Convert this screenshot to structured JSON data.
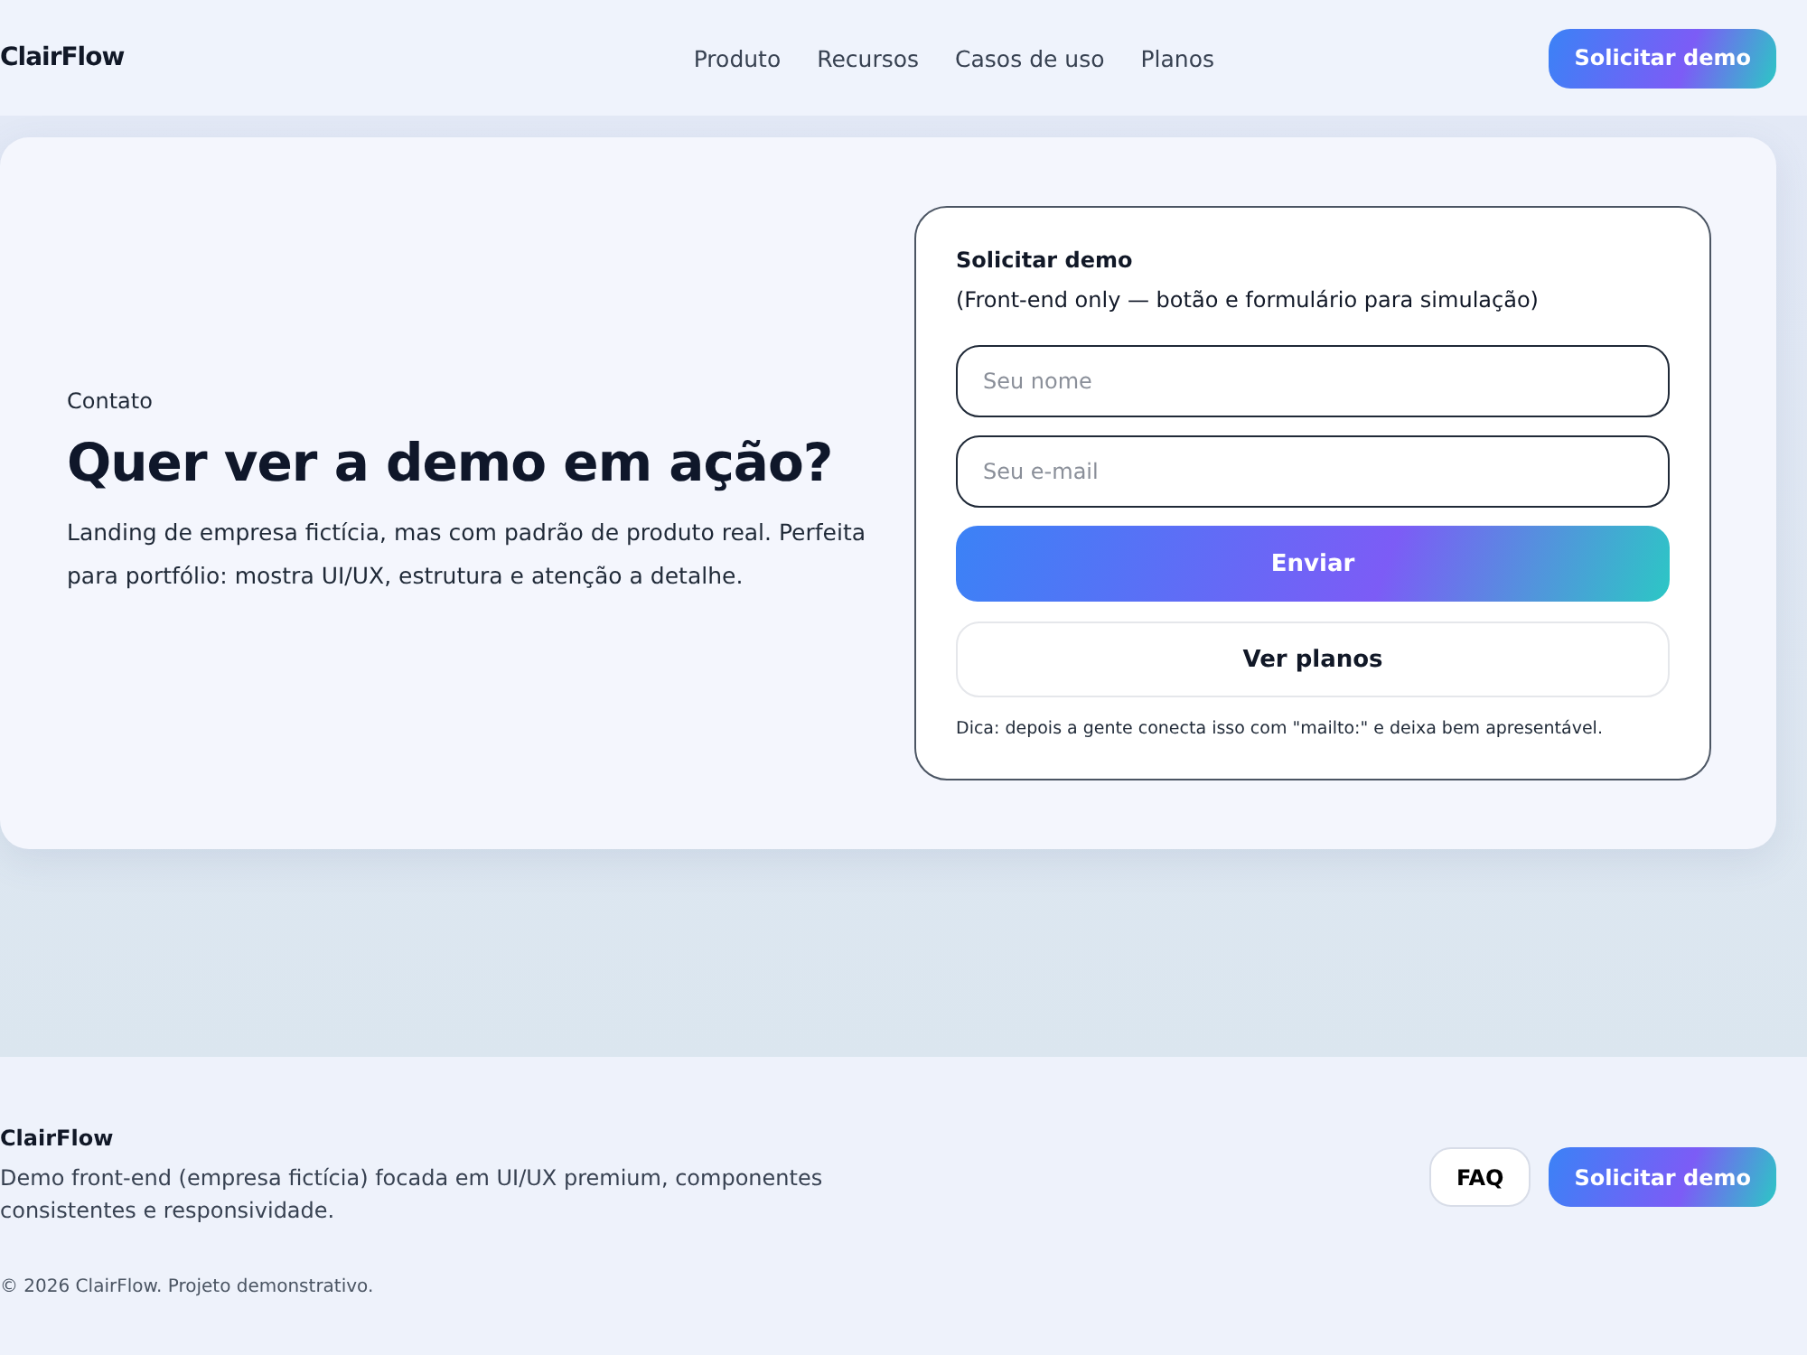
{
  "header": {
    "logo": "ClairFlow",
    "nav": [
      "Produto",
      "Recursos",
      "Casos de uso",
      "Planos"
    ],
    "cta": "Solicitar demo"
  },
  "contact": {
    "eyebrow": "Contato",
    "title": "Quer ver a demo em ação?",
    "description": "Landing de empresa fictícia, mas com padrão de produto real. Perfeita para portfólio: mostra UI/UX, estrutura e atenção a detalhe."
  },
  "form": {
    "title": "Solicitar demo",
    "subtitle": "(Front-end only — botão e formulário para simulação)",
    "fields": [
      {
        "placeholder": "Seu nome"
      },
      {
        "placeholder": "Seu e-mail"
      }
    ],
    "submit": "Enviar",
    "secondary": "Ver planos",
    "hint": "Dica: depois a gente conecta isso com \"mailto:\" e deixa bem apresentável."
  },
  "footer": {
    "brand": "ClairFlow",
    "description": "Demo front-end (empresa fictícia) focada em UI/UX premium, componentes consistentes e responsividade.",
    "buttons": [
      "FAQ",
      "Solicitar demo"
    ],
    "copyright": "© 2026 ClairFlow. Projeto demonstrativo."
  }
}
